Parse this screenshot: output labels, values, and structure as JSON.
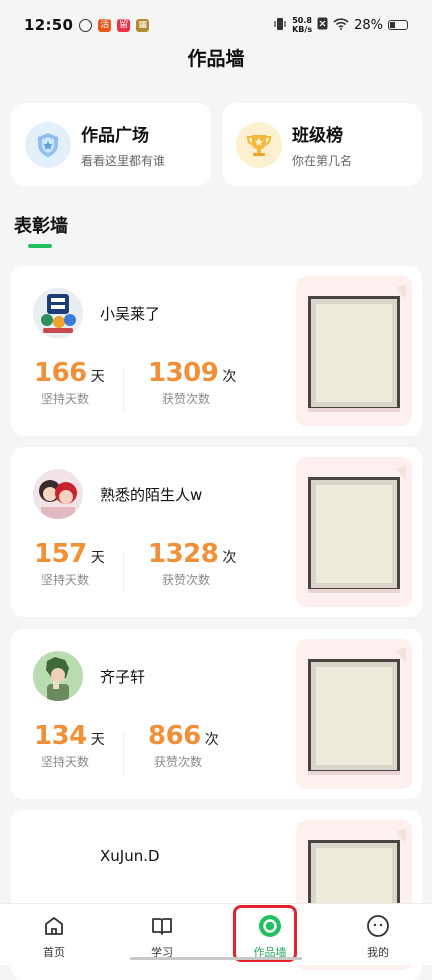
{
  "status_bar": {
    "time": "12:50",
    "net_speed_value": "50.8",
    "net_speed_unit": "KB/s",
    "battery": "28%"
  },
  "page": {
    "title": "作品墙"
  },
  "quick_entries": [
    {
      "title": "作品广场",
      "subtitle": "看看这里都有谁",
      "icon": "badge-shield-icon"
    },
    {
      "title": "班级榜",
      "subtitle": "你在第几名",
      "icon": "trophy-icon"
    }
  ],
  "section": {
    "title": "表彰墙"
  },
  "honor_list": [
    {
      "name": "小吴莱了",
      "days": "166",
      "days_unit": "天",
      "days_label": "坚持天数",
      "likes": "1309",
      "likes_unit": "次",
      "likes_label": "获赞次数"
    },
    {
      "name": "熟悉的陌生人w",
      "days": "157",
      "days_unit": "天",
      "days_label": "坚持天数",
      "likes": "1328",
      "likes_unit": "次",
      "likes_label": "获赞次数"
    },
    {
      "name": "齐子轩",
      "days": "134",
      "days_unit": "天",
      "days_label": "坚持天数",
      "likes": "866",
      "likes_unit": "次",
      "likes_label": "获赞次数"
    },
    {
      "name": "XuJun.D"
    }
  ],
  "bottom_nav": [
    {
      "label": "首页",
      "icon": "home-icon",
      "active": false
    },
    {
      "label": "学习",
      "icon": "book-icon",
      "active": false
    },
    {
      "label": "作品墙",
      "icon": "target-circle-icon",
      "active": true
    },
    {
      "label": "我的",
      "icon": "smiley-face-icon",
      "active": false
    }
  ],
  "colors": {
    "accent_green": "#23c062",
    "stat_orange": "#f0913a",
    "highlight_red": "#e0242c"
  }
}
